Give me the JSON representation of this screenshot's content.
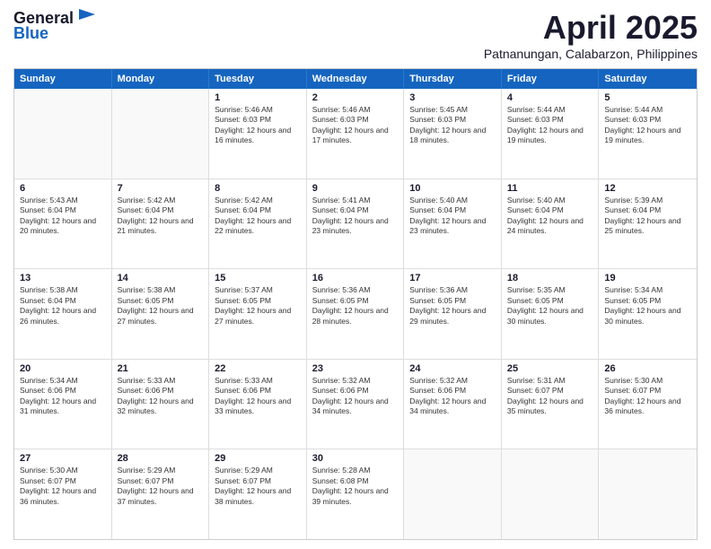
{
  "header": {
    "logo_line1": "General",
    "logo_line2": "Blue",
    "month": "April 2025",
    "location": "Patnanungan, Calabarzon, Philippines"
  },
  "days_of_week": [
    "Sunday",
    "Monday",
    "Tuesday",
    "Wednesday",
    "Thursday",
    "Friday",
    "Saturday"
  ],
  "weeks": [
    [
      {
        "day": "",
        "info": ""
      },
      {
        "day": "",
        "info": ""
      },
      {
        "day": "1",
        "info": "Sunrise: 5:46 AM\nSunset: 6:03 PM\nDaylight: 12 hours and 16 minutes."
      },
      {
        "day": "2",
        "info": "Sunrise: 5:46 AM\nSunset: 6:03 PM\nDaylight: 12 hours and 17 minutes."
      },
      {
        "day": "3",
        "info": "Sunrise: 5:45 AM\nSunset: 6:03 PM\nDaylight: 12 hours and 18 minutes."
      },
      {
        "day": "4",
        "info": "Sunrise: 5:44 AM\nSunset: 6:03 PM\nDaylight: 12 hours and 19 minutes."
      },
      {
        "day": "5",
        "info": "Sunrise: 5:44 AM\nSunset: 6:03 PM\nDaylight: 12 hours and 19 minutes."
      }
    ],
    [
      {
        "day": "6",
        "info": "Sunrise: 5:43 AM\nSunset: 6:04 PM\nDaylight: 12 hours and 20 minutes."
      },
      {
        "day": "7",
        "info": "Sunrise: 5:42 AM\nSunset: 6:04 PM\nDaylight: 12 hours and 21 minutes."
      },
      {
        "day": "8",
        "info": "Sunrise: 5:42 AM\nSunset: 6:04 PM\nDaylight: 12 hours and 22 minutes."
      },
      {
        "day": "9",
        "info": "Sunrise: 5:41 AM\nSunset: 6:04 PM\nDaylight: 12 hours and 23 minutes."
      },
      {
        "day": "10",
        "info": "Sunrise: 5:40 AM\nSunset: 6:04 PM\nDaylight: 12 hours and 23 minutes."
      },
      {
        "day": "11",
        "info": "Sunrise: 5:40 AM\nSunset: 6:04 PM\nDaylight: 12 hours and 24 minutes."
      },
      {
        "day": "12",
        "info": "Sunrise: 5:39 AM\nSunset: 6:04 PM\nDaylight: 12 hours and 25 minutes."
      }
    ],
    [
      {
        "day": "13",
        "info": "Sunrise: 5:38 AM\nSunset: 6:04 PM\nDaylight: 12 hours and 26 minutes."
      },
      {
        "day": "14",
        "info": "Sunrise: 5:38 AM\nSunset: 6:05 PM\nDaylight: 12 hours and 27 minutes."
      },
      {
        "day": "15",
        "info": "Sunrise: 5:37 AM\nSunset: 6:05 PM\nDaylight: 12 hours and 27 minutes."
      },
      {
        "day": "16",
        "info": "Sunrise: 5:36 AM\nSunset: 6:05 PM\nDaylight: 12 hours and 28 minutes."
      },
      {
        "day": "17",
        "info": "Sunrise: 5:36 AM\nSunset: 6:05 PM\nDaylight: 12 hours and 29 minutes."
      },
      {
        "day": "18",
        "info": "Sunrise: 5:35 AM\nSunset: 6:05 PM\nDaylight: 12 hours and 30 minutes."
      },
      {
        "day": "19",
        "info": "Sunrise: 5:34 AM\nSunset: 6:05 PM\nDaylight: 12 hours and 30 minutes."
      }
    ],
    [
      {
        "day": "20",
        "info": "Sunrise: 5:34 AM\nSunset: 6:06 PM\nDaylight: 12 hours and 31 minutes."
      },
      {
        "day": "21",
        "info": "Sunrise: 5:33 AM\nSunset: 6:06 PM\nDaylight: 12 hours and 32 minutes."
      },
      {
        "day": "22",
        "info": "Sunrise: 5:33 AM\nSunset: 6:06 PM\nDaylight: 12 hours and 33 minutes."
      },
      {
        "day": "23",
        "info": "Sunrise: 5:32 AM\nSunset: 6:06 PM\nDaylight: 12 hours and 34 minutes."
      },
      {
        "day": "24",
        "info": "Sunrise: 5:32 AM\nSunset: 6:06 PM\nDaylight: 12 hours and 34 minutes."
      },
      {
        "day": "25",
        "info": "Sunrise: 5:31 AM\nSunset: 6:07 PM\nDaylight: 12 hours and 35 minutes."
      },
      {
        "day": "26",
        "info": "Sunrise: 5:30 AM\nSunset: 6:07 PM\nDaylight: 12 hours and 36 minutes."
      }
    ],
    [
      {
        "day": "27",
        "info": "Sunrise: 5:30 AM\nSunset: 6:07 PM\nDaylight: 12 hours and 36 minutes."
      },
      {
        "day": "28",
        "info": "Sunrise: 5:29 AM\nSunset: 6:07 PM\nDaylight: 12 hours and 37 minutes."
      },
      {
        "day": "29",
        "info": "Sunrise: 5:29 AM\nSunset: 6:07 PM\nDaylight: 12 hours and 38 minutes."
      },
      {
        "day": "30",
        "info": "Sunrise: 5:28 AM\nSunset: 6:08 PM\nDaylight: 12 hours and 39 minutes."
      },
      {
        "day": "",
        "info": ""
      },
      {
        "day": "",
        "info": ""
      },
      {
        "day": "",
        "info": ""
      }
    ]
  ]
}
